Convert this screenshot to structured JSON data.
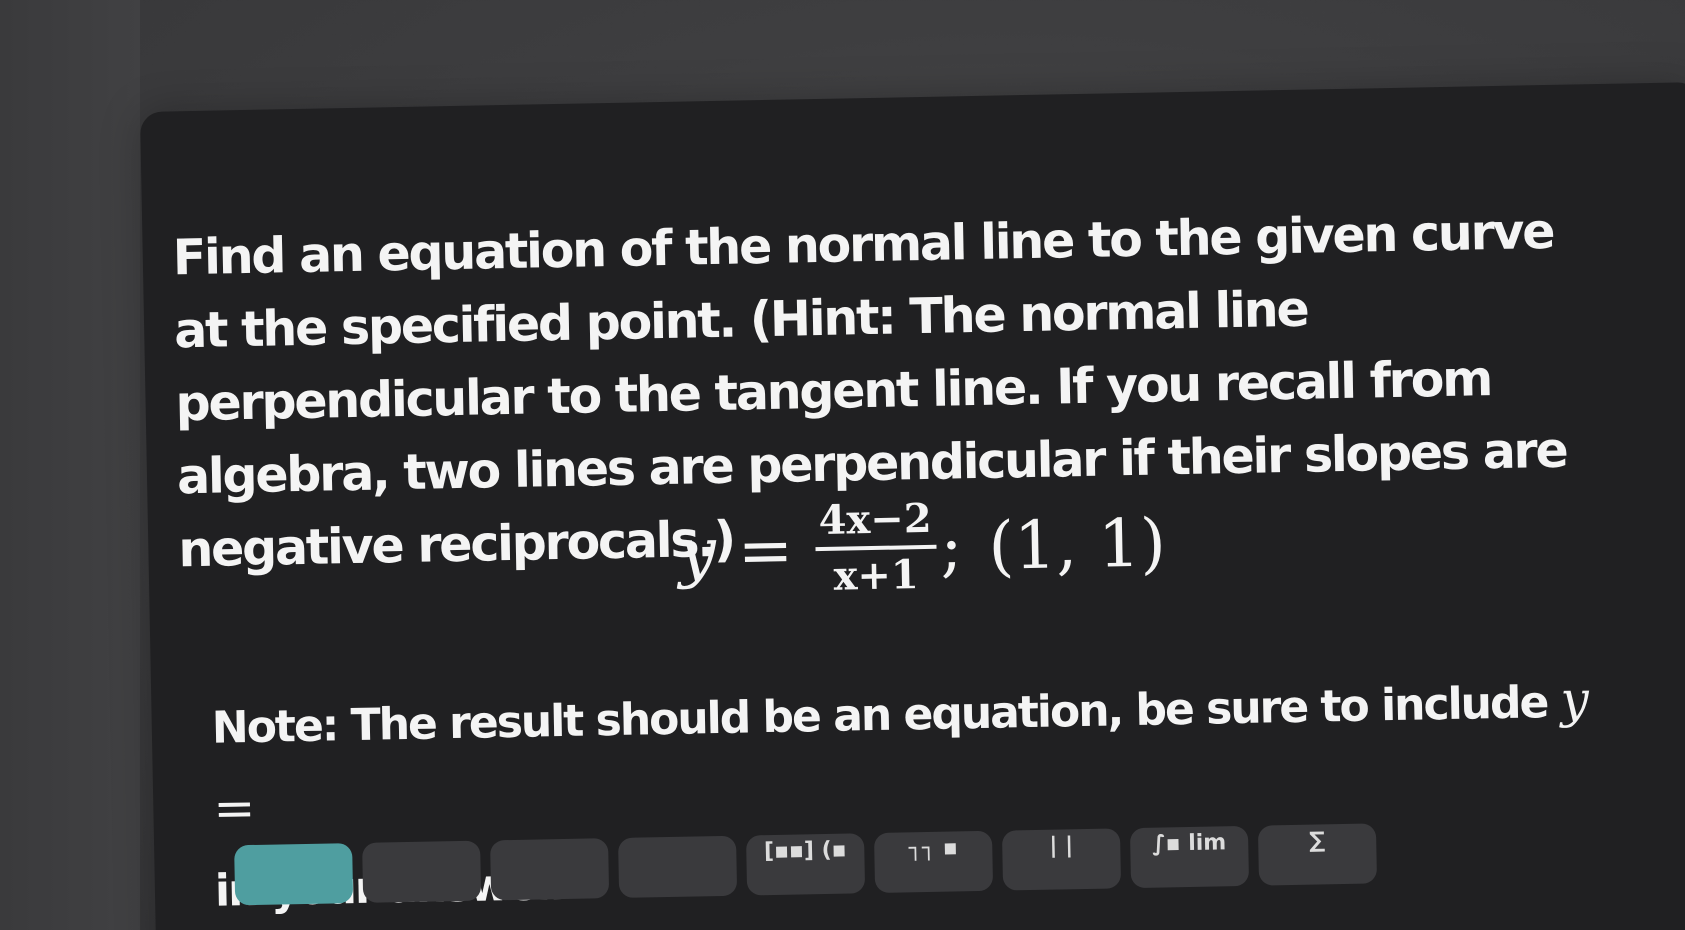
{
  "question": {
    "text": "Find an equation of the normal line to the given curve at the specified point. (Hint: The normal line perpendicular to the tangent line. If you recall from algebra, two lines are perpendicular if their slopes are negative reciprocals.)"
  },
  "equation": {
    "lhs": "y",
    "equals": "=",
    "numerator": "4x−2",
    "denominator": "x+1",
    "separator": ";",
    "point": "(1, 1)"
  },
  "note": {
    "text": "Note: The result should be an equation, be sure to include",
    "math": "y =",
    "suffix": "in your answer."
  },
  "toolbar": {
    "buttons": [
      {
        "label": "",
        "icon": "blank"
      },
      {
        "label": "",
        "icon": "blank"
      },
      {
        "label": "",
        "icon": "blank"
      },
      {
        "label": "",
        "icon": "blank"
      },
      {
        "label": "[▪▪] (▪",
        "icon": "matrix-icon"
      },
      {
        "label": "┐┐ ▪",
        "icon": "subscript-icon"
      },
      {
        "label": "| |",
        "icon": "absolute-value-icon"
      },
      {
        "label": "∫▪ lim",
        "icon": "calculus-icon"
      },
      {
        "label": "∑",
        "icon": "sum-icon"
      }
    ],
    "accent_color": "#4f9ea0"
  }
}
